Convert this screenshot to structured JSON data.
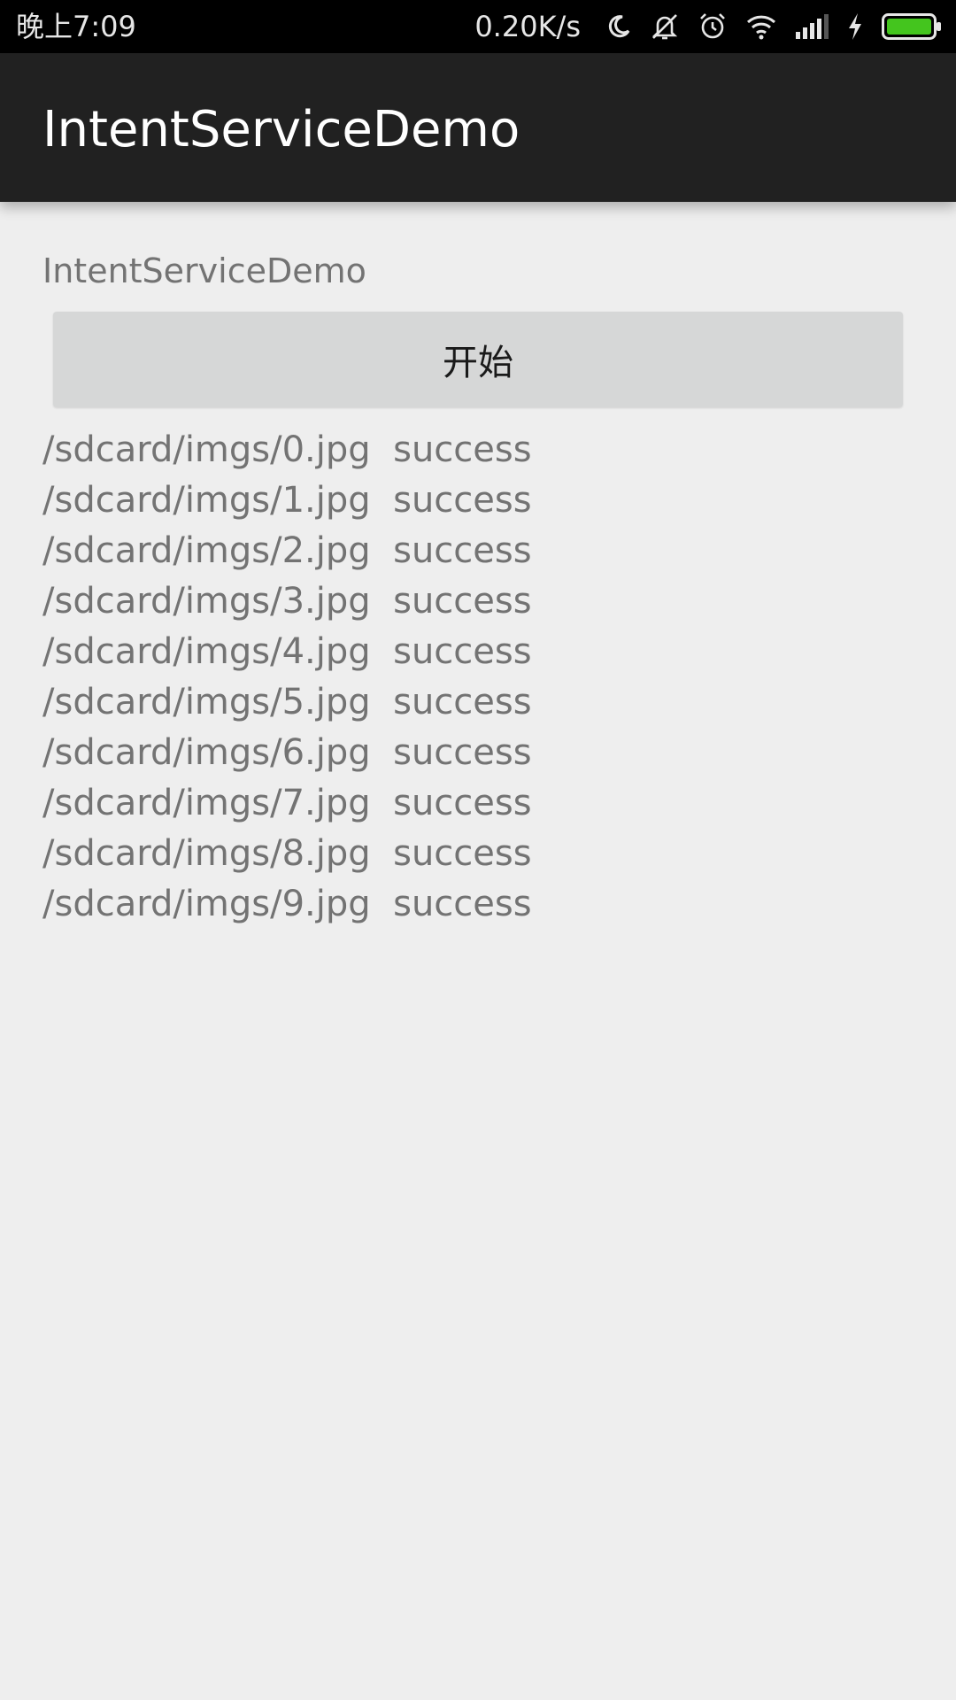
{
  "status_bar": {
    "time": "晚上7:09",
    "net_speed": "0.20K/s",
    "icons": [
      "moon-icon",
      "mute-icon",
      "alarm-icon",
      "wifi-icon",
      "signal-icon",
      "charging-icon",
      "battery-icon"
    ],
    "battery_color": "#44c51e",
    "background": "#000000"
  },
  "app_bar": {
    "title": "IntentServiceDemo",
    "background": "#212121"
  },
  "main": {
    "label": "IntentServiceDemo",
    "start_button_label": "开始",
    "results": [
      {
        "path": "/sdcard/imgs/0.jpg",
        "status": "success"
      },
      {
        "path": "/sdcard/imgs/1.jpg",
        "status": "success"
      },
      {
        "path": "/sdcard/imgs/2.jpg",
        "status": "success"
      },
      {
        "path": "/sdcard/imgs/3.jpg",
        "status": "success"
      },
      {
        "path": "/sdcard/imgs/4.jpg",
        "status": "success"
      },
      {
        "path": "/sdcard/imgs/5.jpg",
        "status": "success"
      },
      {
        "path": "/sdcard/imgs/6.jpg",
        "status": "success"
      },
      {
        "path": "/sdcard/imgs/7.jpg",
        "status": "success"
      },
      {
        "path": "/sdcard/imgs/8.jpg",
        "status": "success"
      },
      {
        "path": "/sdcard/imgs/9.jpg",
        "status": "success"
      }
    ]
  }
}
